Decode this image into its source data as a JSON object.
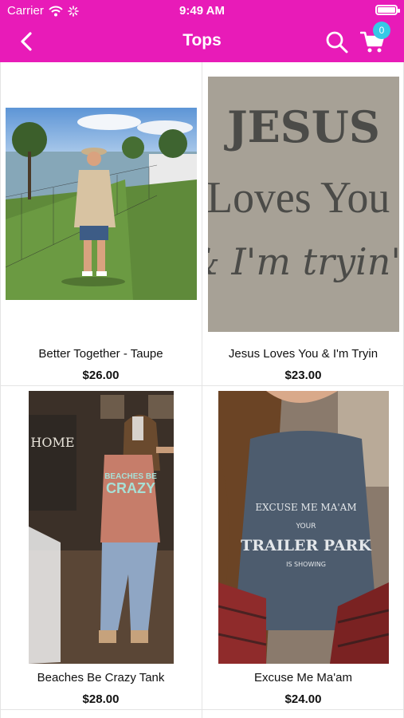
{
  "status": {
    "carrier": "Carrier",
    "time": "9:49 AM"
  },
  "nav": {
    "title": "Tops",
    "cart_count": "0"
  },
  "products": [
    {
      "name": "Better Together - Taupe",
      "price": "$26.00"
    },
    {
      "name": "Jesus Loves You & I'm Tryin",
      "price": "$23.00"
    },
    {
      "name": "Beaches Be Crazy Tank",
      "price": "$28.00"
    },
    {
      "name": "Excuse Me Ma'am",
      "price": "$24.00"
    }
  ],
  "images": {
    "shirt2": {
      "line1": "JESUS",
      "line2": "Loves You",
      "line3": "& I'm tryin'"
    },
    "shirt3": {
      "line1": "BEACHES BE",
      "line2": "CRAZY",
      "sign": "HOME"
    },
    "shirt4": {
      "line1": "EXCUSE ME MA'AM",
      "line2": "YOUR",
      "line3": "TRAILER PARK",
      "line4": "IS SHOWING"
    }
  },
  "colors": {
    "brand": "#e81bb8",
    "badge": "#36c9e6"
  }
}
